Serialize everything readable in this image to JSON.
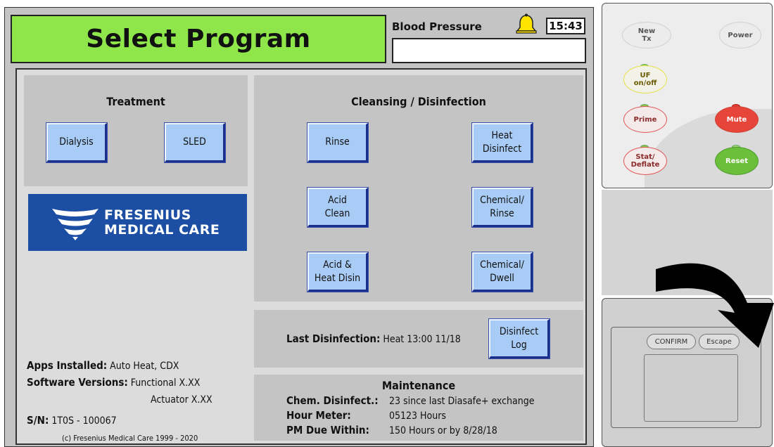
{
  "header": {
    "title": "Select Program",
    "blood_pressure_label": "Blood Pressure",
    "blood_pressure_value": "",
    "clock": "15:43"
  },
  "treatment": {
    "title": "Treatment",
    "buttons": [
      "Dialysis",
      "SLED"
    ]
  },
  "cleansing": {
    "title": "Cleansing / Disinfection",
    "buttons": [
      "Rinse",
      "Heat\nDisinfect",
      "Acid\nClean",
      "Chemical/\nRinse",
      "Acid &\nHeat Disin",
      "Chemical/\nDwell"
    ]
  },
  "logo": {
    "line1": "FRESENIUS",
    "line2": "MEDICAL CARE",
    "color": "#1c4fa3"
  },
  "info": {
    "apps_label": "Apps Installed:",
    "apps_value": "Auto Heat, CDX",
    "software_label": "Software Versions:",
    "functional": "Functional X.XX",
    "actuator": "Actuator X.XX",
    "sn_label": "S/N:",
    "sn_value": "1T0S - 100067",
    "copyright": "(c) Fresenius Medical Care 1999 - 2020"
  },
  "disinfection": {
    "label": "Last Disinfection:",
    "value": "Heat 13:00  11/18",
    "log_button": "Disinfect\nLog"
  },
  "maintenance": {
    "title": "Maintenance",
    "rows": [
      {
        "key": "Chem. Disinfect.:",
        "value": "23 since last Diasafe+ exchange"
      },
      {
        "key": "Hour Meter:",
        "value": "05123 Hours"
      },
      {
        "key": "PM Due Within:",
        "value": "150 Hours or by 8/28/18"
      }
    ]
  },
  "hardware": {
    "keys": {
      "new_tx": "New\nTx",
      "power": "Power",
      "uf": "UF\non/off",
      "prime": "Prime",
      "mute": "Mute",
      "stat": "Stat/\nDeflate",
      "reset": "Reset"
    },
    "confirm": "CONFIRM",
    "escape": "Escape"
  },
  "colors": {
    "title_green": "#8ee64a",
    "button_blue": "#a8ccf5",
    "mute_red": "#e8453a",
    "reset_green": "#6cbf3a"
  }
}
